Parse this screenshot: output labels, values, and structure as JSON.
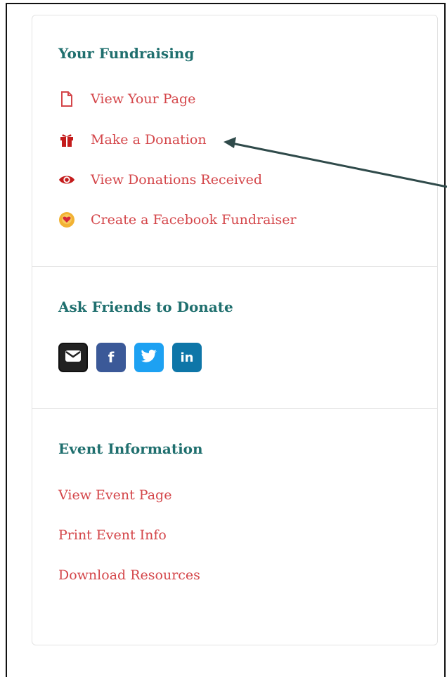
{
  "sections": {
    "fundraising": {
      "title": "Your Fundraising",
      "links": [
        {
          "label": "View Your Page",
          "icon": "page-icon"
        },
        {
          "label": "Make a Donation",
          "icon": "gift-icon"
        },
        {
          "label": "View Donations Received",
          "icon": "eye-icon"
        },
        {
          "label": "Create a Facebook Fundraiser",
          "icon": "heart-coin-icon"
        }
      ]
    },
    "ask_friends": {
      "title": "Ask Friends to Donate",
      "share": [
        {
          "name": "email",
          "icon": "envelope-icon",
          "color": "#222222"
        },
        {
          "name": "facebook",
          "icon": "facebook-icon",
          "glyph": "f",
          "color": "#3b5998"
        },
        {
          "name": "twitter",
          "icon": "twitter-icon",
          "color": "#1da1f2"
        },
        {
          "name": "linkedin",
          "icon": "linkedin-icon",
          "glyph": "in",
          "color": "#0e76a8"
        }
      ]
    },
    "event_info": {
      "title": "Event Information",
      "links": [
        {
          "label": "View Event Page"
        },
        {
          "label": "Print Event Info"
        },
        {
          "label": "Download Resources"
        }
      ]
    }
  },
  "colors": {
    "heading": "#1f6f6e",
    "link": "#d4464a",
    "annotation_arrow": "#2f4a4a"
  }
}
